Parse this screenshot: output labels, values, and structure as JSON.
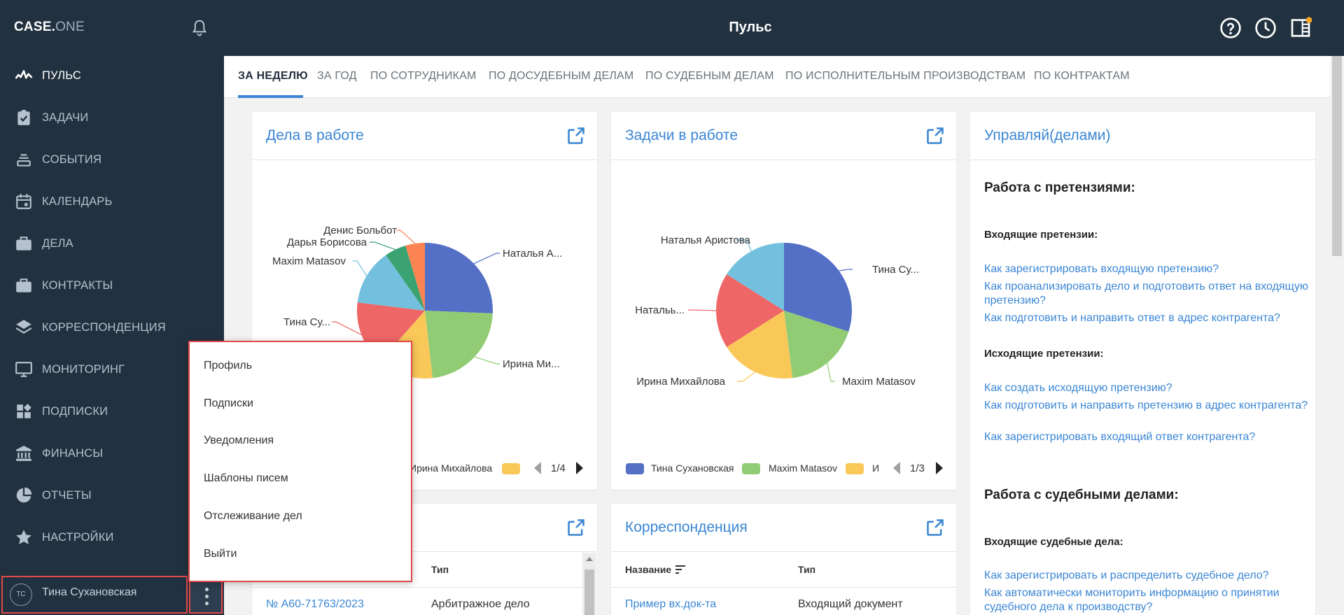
{
  "app": {
    "logo_main": "CASE.",
    "logo_sub": "ONE",
    "page_title": "Пульс"
  },
  "sidebar": {
    "items": [
      {
        "label": "ПУЛЬС",
        "icon": "pulse-icon",
        "active": true
      },
      {
        "label": "ЗАДАЧИ",
        "icon": "clipboard-check-icon"
      },
      {
        "label": "СОБЫТИЯ",
        "icon": "events-stack-icon"
      },
      {
        "label": "КАЛЕНДАРЬ",
        "icon": "calendar-icon"
      },
      {
        "label": "ДЕЛА",
        "icon": "briefcase-icon"
      },
      {
        "label": "КОНТРАКТЫ",
        "icon": "briefcase-icon"
      },
      {
        "label": "КОРРЕСПОНДЕНЦИЯ",
        "icon": "layers-icon"
      },
      {
        "label": "МОНИТОРИНГ",
        "icon": "monitor-icon"
      },
      {
        "label": "ПОДПИСКИ",
        "icon": "widgets-icon"
      },
      {
        "label": "ФИНАНСЫ",
        "icon": "bank-icon"
      },
      {
        "label": "ОТЧЕТЫ",
        "icon": "pie-chart-icon"
      },
      {
        "label": "НАСТРОЙКИ",
        "icon": "star-icon"
      }
    ],
    "user": {
      "initials": "ТС",
      "name": "Тина Сухановская"
    }
  },
  "tabs": [
    {
      "label": "ЗА НЕДЕЛЮ",
      "active": true
    },
    {
      "label": "ЗА ГОД"
    },
    {
      "label": "ПО СОТРУДНИКАМ"
    },
    {
      "label": "ПО ДОСУДЕБНЫМ ДЕЛАМ"
    },
    {
      "label": "ПО СУДЕБНЫМ ДЕЛАМ"
    },
    {
      "label": "ПО ИСПОЛНИТЕЛЬНЫМ ПРОИЗВОДСТВАМ"
    },
    {
      "label": "ПО КОНТРАКТАМ"
    }
  ],
  "cards": {
    "cases": {
      "title": "Дела в работе",
      "legend_label": "Ирина Михайлова",
      "pager": "1/4"
    },
    "tasks": {
      "title": "Задачи в работе",
      "legend": [
        "Тина Сухановская",
        "Maxim Matasov",
        "И"
      ],
      "pager": "1/3"
    },
    "help": {
      "title": "Управляй(делами)",
      "claims_title": "Работа с претензиями:",
      "incoming_title": "Входящие претензии:",
      "incoming_links": [
        "Как зарегистрировать входящую претензию?",
        "Как проанализировать дело и подготовить ответ на входящую претензию?",
        "Как подготовить и направить ответ в адрес контрагента?"
      ],
      "outgoing_title": "Исходящие претензии:",
      "outgoing_links": [
        "Как создать исходящую претензию?",
        "Как подготовить и направить претензию в адрес контрагента?",
        "Как зарегистрировать входящий ответ контрагента?"
      ],
      "court_title": "Работа с судебными делами:",
      "court_incoming_title": "Входящие судебные дела:",
      "court_links": [
        "Как зарегистрировать и распределить судебное дело?",
        "Как автоматически мониторить информацию о принятии судебного дела к производству?"
      ]
    },
    "lower_left": {
      "col_type": "Тип",
      "row_number": "№ А60-71763/2023",
      "row_type": "Арбитражное дело"
    },
    "correspondence": {
      "title": "Корреспонденция",
      "col_name": "Название",
      "col_type": "Тип",
      "row_name": "Пример вх.док-та",
      "row_type": "Входящий документ"
    }
  },
  "menu": {
    "items": [
      "Профиль",
      "Подписки",
      "Уведомления",
      "Шаблоны писем",
      "Отслеживание дел",
      "Выйти"
    ]
  },
  "colors": {
    "blue": "#5470c6",
    "green": "#91cc75",
    "yellow": "#fac858",
    "red": "#ee6666",
    "cyan": "#73c0de",
    "teal": "#3ba272",
    "orange": "#fc8452",
    "sidebar": "#223140",
    "link": "#3a86d4"
  },
  "chart_data": [
    {
      "type": "pie",
      "title": "Дела в работе",
      "slices": [
        {
          "label": "Наталья А...",
          "value": 25,
          "color": "#5470c6"
        },
        {
          "label": "Ирина Ми...",
          "value": 22,
          "color": "#91cc75"
        },
        {
          "label": "",
          "value": 13,
          "color": "#fac858"
        },
        {
          "label": "Тина Су...",
          "value": 15,
          "color": "#ee6666"
        },
        {
          "label": "Maxim Matasov",
          "value": 13,
          "color": "#73c0de"
        },
        {
          "label": "Дарья Борисова",
          "value": 5,
          "color": "#3ba272"
        },
        {
          "label": "Денис Больбот",
          "value": 4.5,
          "color": "#fc8452"
        }
      ]
    },
    {
      "type": "pie",
      "title": "Задачи в работе",
      "slices": [
        {
          "label": "Тина Су...",
          "value": 30,
          "color": "#5470c6"
        },
        {
          "label": "Maxim Matasov",
          "value": 18,
          "color": "#91cc75"
        },
        {
          "label": "Ирина Михайлова",
          "value": 18,
          "color": "#fac858"
        },
        {
          "label": "Натальь...",
          "value": 18,
          "color": "#ee6666"
        },
        {
          "label": "Наталья Аристова",
          "value": 16,
          "color": "#73c0de"
        }
      ]
    }
  ]
}
